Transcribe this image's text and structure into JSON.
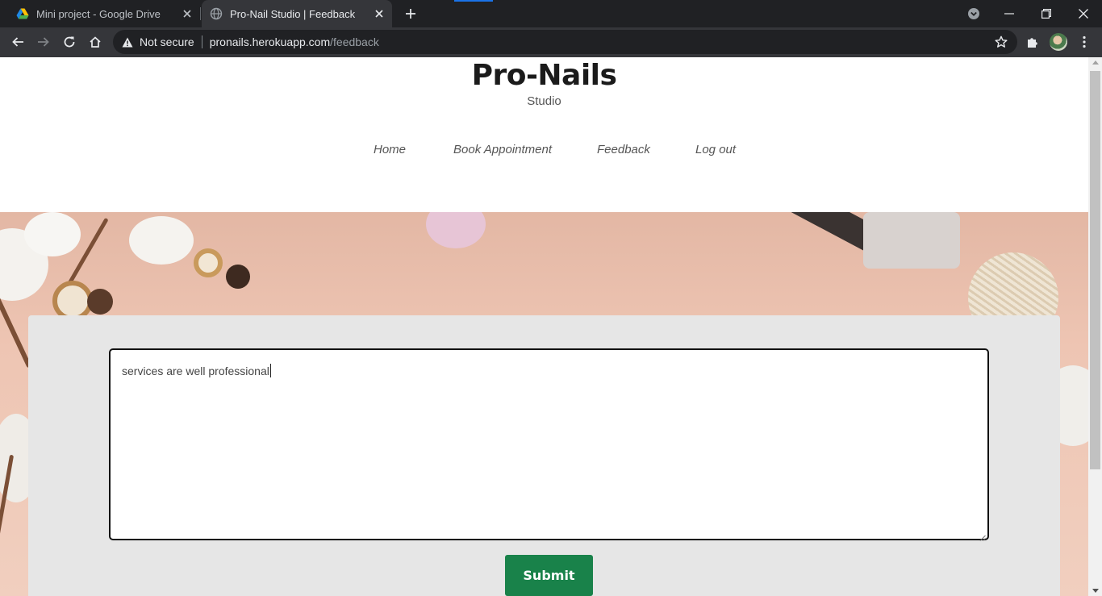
{
  "browser": {
    "tabs": [
      {
        "title": "Mini project - Google Drive",
        "active": false
      },
      {
        "title": "Pro-Nail Studio | Feedback",
        "active": true
      }
    ],
    "security_label": "Not secure",
    "url_host": "pronails.herokuapp.com",
    "url_path": "/feedback"
  },
  "site": {
    "title": "Pro-Nails",
    "subtitle": "Studio",
    "nav": [
      {
        "label": "Home"
      },
      {
        "label": "Book Appointment"
      },
      {
        "label": "Feedback"
      },
      {
        "label": "Log out"
      }
    ]
  },
  "feedback": {
    "text": "services are well professional",
    "submit_label": "Submit"
  },
  "colors": {
    "submit_bg": "#19824a",
    "chrome_dark": "#202124",
    "chrome_toolbar": "#35363a"
  }
}
